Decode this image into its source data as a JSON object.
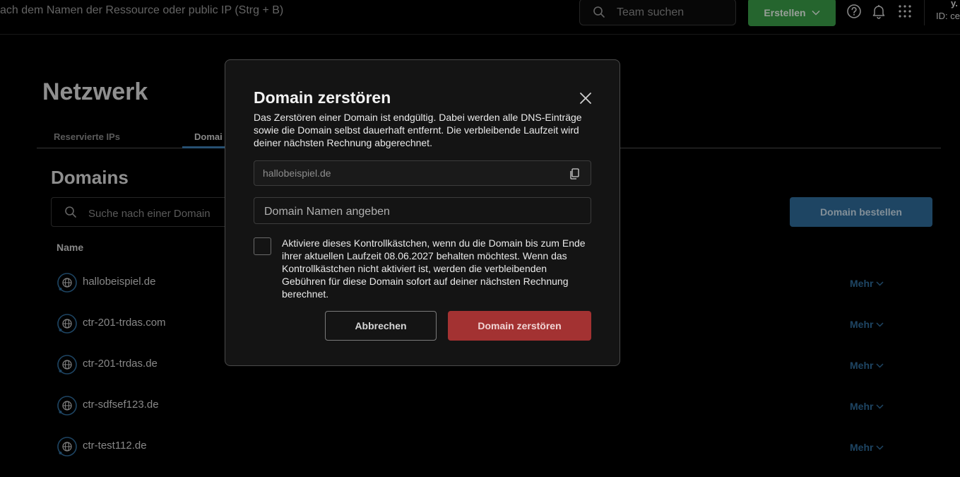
{
  "topbar": {
    "global_search_placeholder": "ach dem Namen der Ressource oder public IP (Strg + B)",
    "team_search_placeholder": "Team suchen",
    "create_label": "Erstellen",
    "user_short": "y.",
    "user_id": "ID: ce"
  },
  "page": {
    "title": "Netzwerk",
    "tabs": [
      {
        "label": "Reservierte IPs"
      },
      {
        "label": "Domai"
      }
    ],
    "section_title": "Domains",
    "domain_search_placeholder": "Suche nach einer Domain",
    "order_button_label": "Domain bestellen",
    "column_name": "Name",
    "domains": [
      {
        "name": "hallobeispiel.de",
        "action": "Mehr"
      },
      {
        "name": "ctr-201-trdas.com",
        "action": "Mehr"
      },
      {
        "name": "ctr-201-trdas.de",
        "action": "Mehr"
      },
      {
        "name": "ctr-sdfsef123.de",
        "action": "Mehr"
      },
      {
        "name": "ctr-test112.de",
        "action": "Mehr"
      }
    ]
  },
  "modal": {
    "title": "Domain zerstören",
    "description": "Das Zerstören einer Domain ist endgültig. Dabei werden alle DNS-Einträge sowie die Domain selbst dauerhaft entfernt. Die verbleibende Laufzeit wird deiner nächsten Rechnung abgerechnet.",
    "domain_value": "hallobeispiel.de",
    "name_input_placeholder": "Domain Namen angeben",
    "checkbox_label": "Aktiviere dieses Kontrollkästchen, wenn du die Domain bis zum Ende ihrer aktuellen Laufzeit 08.06.2027 behalten möchtest. Wenn das Kontrollkästchen nicht aktiviert ist, werden die verbleibenden Gebühren für diese Domain sofort auf deiner nächsten Rechnung berechnet.",
    "checkbox_checked": false,
    "cancel_label": "Abbrechen",
    "destroy_label": "Domain zerstören"
  },
  "colors": {
    "create_green": "#3a9b48",
    "primary_blue": "#2e6a99",
    "danger_red": "#a33232"
  },
  "icons": [
    "search-icon",
    "chevron-down-icon",
    "help-icon",
    "bell-icon",
    "apps-grid-icon",
    "globe-icon",
    "close-icon",
    "copy-icon"
  ]
}
